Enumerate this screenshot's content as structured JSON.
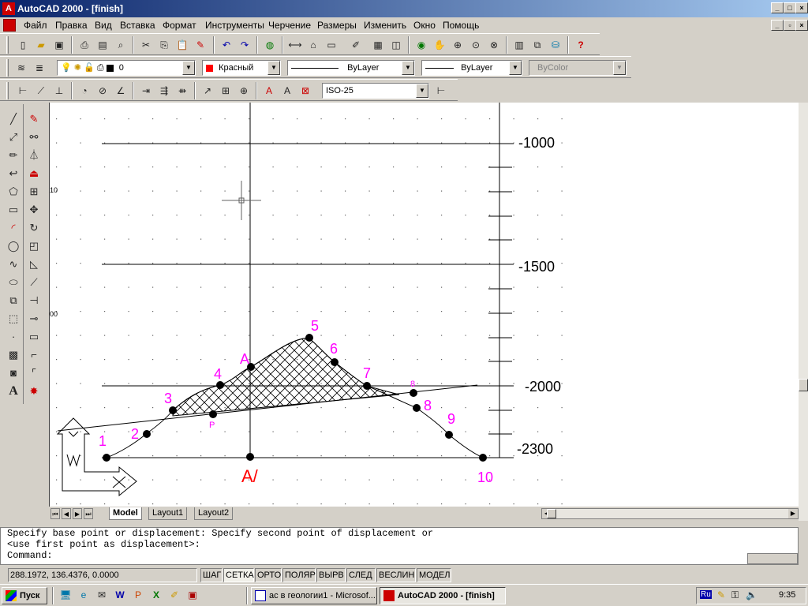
{
  "window": {
    "title": "AutoCAD 2000 - [finish]"
  },
  "menu": [
    "Файл",
    "Правка",
    "Вид",
    "Вставка",
    "Формат",
    "Инструменты",
    "Черчение",
    "Размеры",
    "Изменить",
    "Окно",
    "Помощь"
  ],
  "properties": {
    "layer": "0",
    "color": "Красный",
    "linetype": "ByLayer",
    "lineweight": "ByLayer",
    "plotstyle": "ByColor"
  },
  "dimstyle": "ISO-25",
  "drawing": {
    "scale_labels": [
      "-1000",
      "-1500",
      "-2000",
      "-2300"
    ],
    "point_labels": [
      "1",
      "2",
      "3",
      "4",
      "5",
      "6",
      "7",
      "8",
      "9",
      "10"
    ],
    "A_label": "A",
    "A_prime_label": "A/",
    "small_labels": [
      "P",
      "8"
    ],
    "edge_labels": [
      "10",
      "00"
    ]
  },
  "layout_tabs": [
    "Model",
    "Layout1",
    "Layout2"
  ],
  "command": {
    "line1": "Specify base point or displacement: Specify second point of displacement or",
    "line2": "<use first point as displacement>:",
    "prompt": "Command:"
  },
  "status": {
    "coords": "288.1972, 136.4376, 0.0000",
    "toggles": [
      "ШАГ",
      "СЕТКА",
      "ОРТО",
      "ПОЛЯР",
      "ВЫРВ",
      "СЛЕД",
      "ВЕСЛИН",
      "МОДЕЛЬ"
    ]
  },
  "taskbar": {
    "start": "Пуск",
    "tasks": [
      "ас в геологии1 - Microsof...",
      "AutoCAD 2000 - [finish]"
    ],
    "lang": "Ru",
    "time": "9:35"
  },
  "colors": {
    "accent_magenta": "#ff00ff",
    "accent_red": "#ff0000",
    "title_blue": "#0a246a"
  }
}
